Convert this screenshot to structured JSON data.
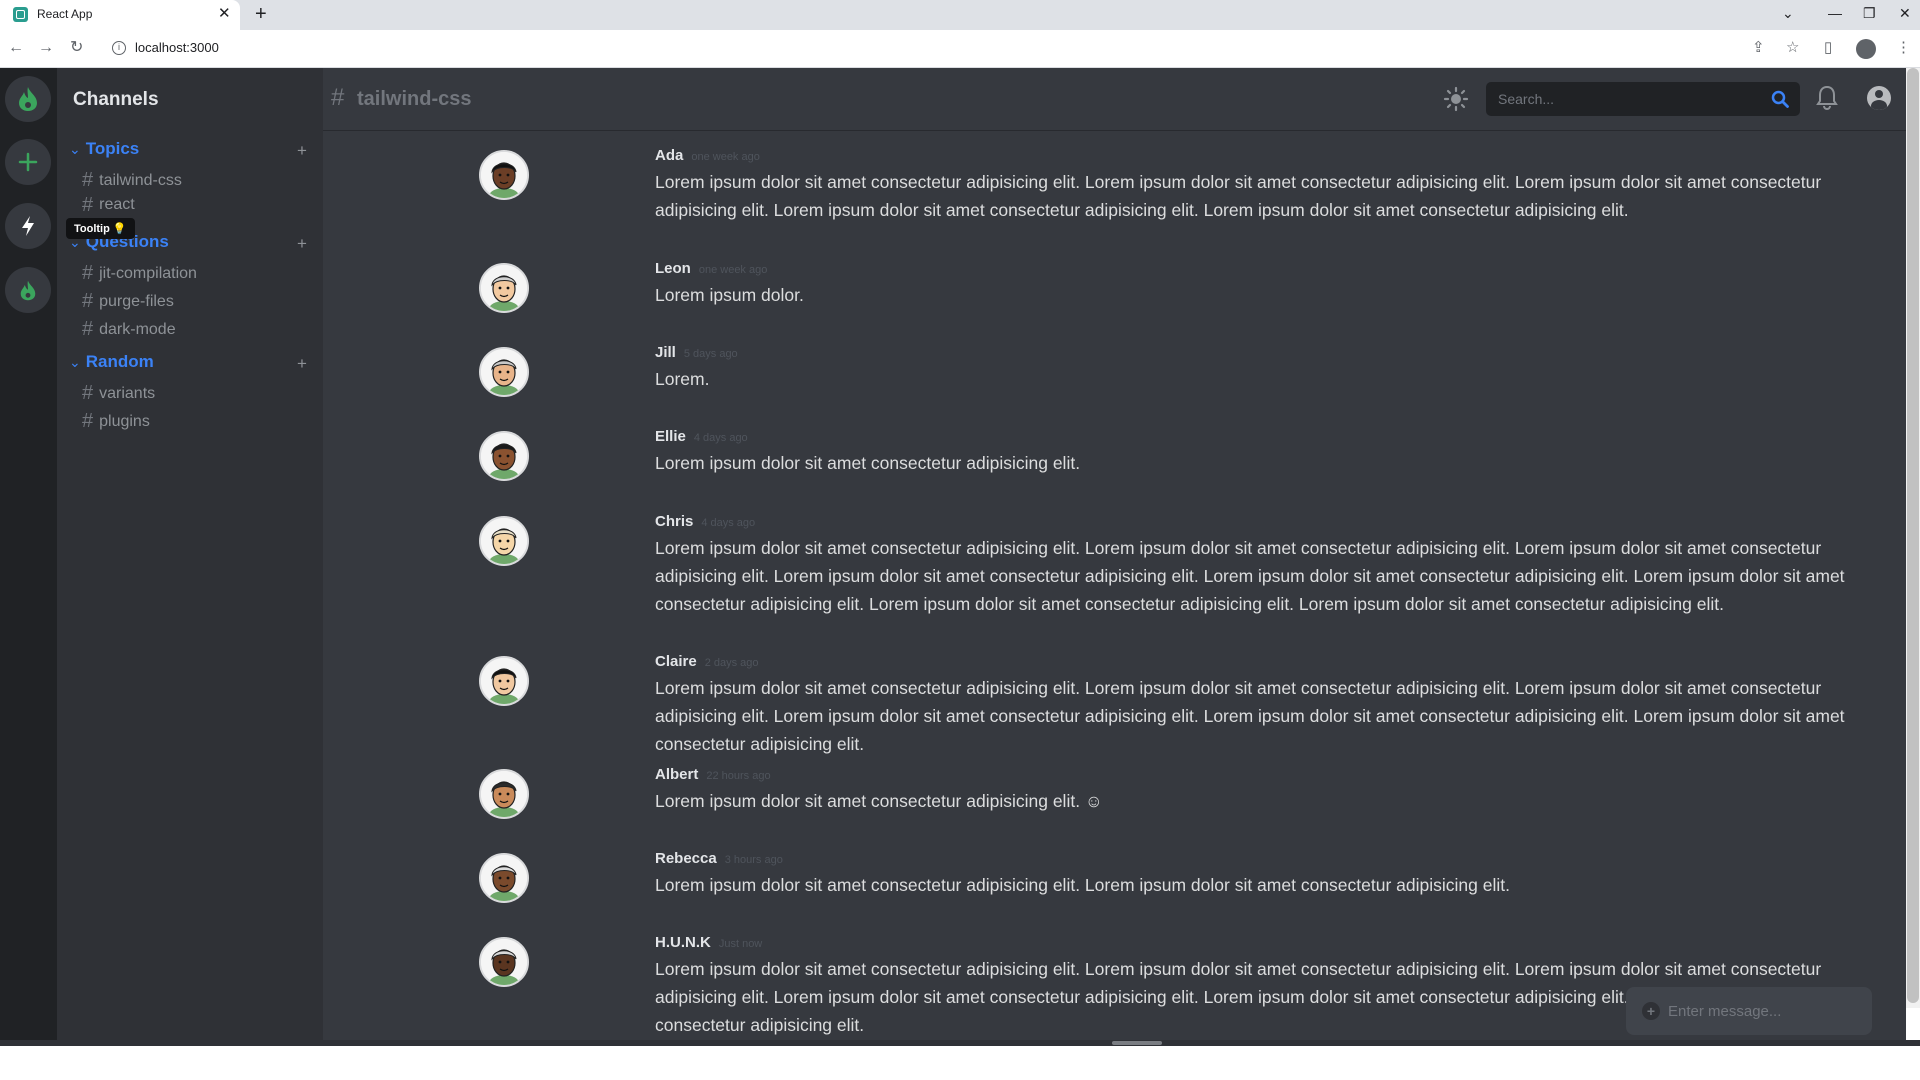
{
  "browser": {
    "tab_title": "React App",
    "tab_close": "✕",
    "new_tab": "+",
    "url": "localhost:3000",
    "window_controls": [
      "⌄",
      "—",
      "❐",
      "✕"
    ]
  },
  "app": {
    "tooltip": "Tooltip 💡",
    "channels_title": "Channels",
    "groups": [
      {
        "label": "Topics",
        "channels": [
          "tailwind-css",
          "react"
        ]
      },
      {
        "label": "Questions",
        "channels": [
          "jit-compilation",
          "purge-files",
          "dark-mode"
        ]
      },
      {
        "label": "Random",
        "channels": [
          "variants",
          "plugins"
        ]
      }
    ],
    "header": {
      "hash": "#",
      "channel": "tailwind-css",
      "search_placeholder": "Search..."
    },
    "messages": [
      {
        "author": "Ada",
        "time": "one week ago",
        "text": "Lorem ipsum dolor sit amet consectetur adipisicing elit. Lorem ipsum dolor sit amet consectetur adipisicing elit. Lorem ipsum dolor sit amet consectetur adipisicing elit. Lorem ipsum dolor sit amet consectetur adipisicing elit. Lorem ipsum dolor sit amet consectetur adipisicing elit."
      },
      {
        "author": "Leon",
        "time": "one week ago",
        "text": "Lorem ipsum dolor."
      },
      {
        "author": "Jill",
        "time": "5 days ago",
        "text": "Lorem."
      },
      {
        "author": "Ellie",
        "time": "4 days ago",
        "text": "Lorem ipsum dolor sit amet consectetur adipisicing elit."
      },
      {
        "author": "Chris",
        "time": "4 days ago",
        "text": "Lorem ipsum dolor sit amet consectetur adipisicing elit. Lorem ipsum dolor sit amet consectetur adipisicing elit. Lorem ipsum dolor sit amet consectetur adipisicing elit. Lorem ipsum dolor sit amet consectetur adipisicing elit. Lorem ipsum dolor sit amet consectetur adipisicing elit. Lorem ipsum dolor sit amet consectetur adipisicing elit. Lorem ipsum dolor sit amet consectetur adipisicing elit. Lorem ipsum dolor sit amet consectetur adipisicing elit."
      },
      {
        "author": "Claire",
        "time": "2 days ago",
        "text": "Lorem ipsum dolor sit amet consectetur adipisicing elit. Lorem ipsum dolor sit amet consectetur adipisicing elit. Lorem ipsum dolor sit amet consectetur adipisicing elit. Lorem ipsum dolor sit amet consectetur adipisicing elit. Lorem ipsum dolor sit amet consectetur adipisicing elit. Lorem ipsum dolor sit amet consectetur adipisicing elit."
      },
      {
        "author": "Albert",
        "time": "22 hours ago",
        "text": "Lorem ipsum dolor sit amet consectetur adipisicing elit. ☺"
      },
      {
        "author": "Rebecca",
        "time": "3 hours ago",
        "text": "Lorem ipsum dolor sit amet consectetur adipisicing elit. Lorem ipsum dolor sit amet consectetur adipisicing elit."
      },
      {
        "author": "H.U.N.K",
        "time": "Just now",
        "text": "Lorem ipsum dolor sit amet consectetur adipisicing elit. Lorem ipsum dolor sit amet consectetur adipisicing elit. Lorem ipsum dolor sit amet consectetur adipisicing elit. Lorem ipsum dolor sit amet consectetur adipisicing elit. Lorem ipsum dolor sit amet consectetur adipisicing elit. Lorem ipsum dolor sit amet consectetur adipisicing elit."
      }
    ],
    "composer_placeholder": "Enter message...",
    "composer_plus": "+"
  },
  "colors": {
    "accent": "#3b82f6",
    "brand_green": "#3ba55d",
    "rail_bg": "#202225",
    "channels_bg": "#2f3136",
    "main_bg": "#36393f"
  },
  "icons": [
    "flame-icon",
    "plus-icon",
    "bolt-icon",
    "theme-toggle-icon",
    "search-icon",
    "bell-icon",
    "user-icon"
  ]
}
